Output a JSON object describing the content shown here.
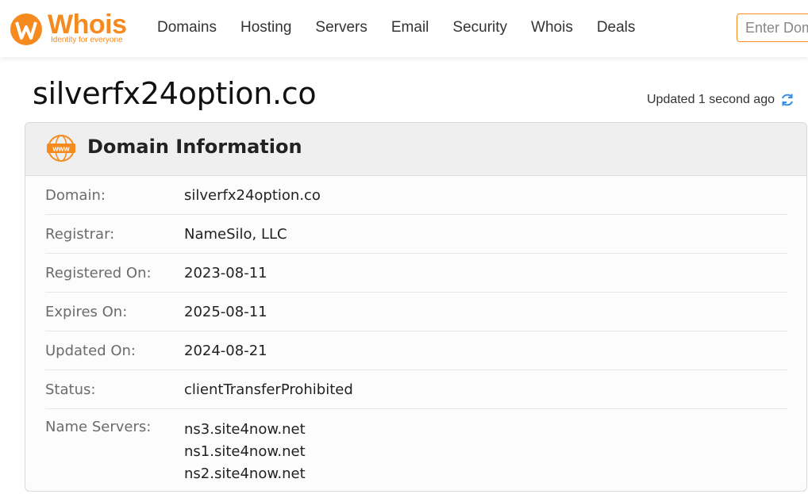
{
  "header": {
    "logo_text": "Whois",
    "logo_tagline": "Identity for everyone",
    "nav": [
      "Domains",
      "Hosting",
      "Servers",
      "Email",
      "Security",
      "Whois",
      "Deals"
    ],
    "search_placeholder": "Enter Domain or IP"
  },
  "page": {
    "title": "silverfx24option.co",
    "updated_text": "Updated 1 second ago"
  },
  "card": {
    "title": "Domain Information",
    "icon_text": "www",
    "rows": [
      {
        "label": "Domain:",
        "value": "silverfx24option.co"
      },
      {
        "label": "Registrar:",
        "value": "NameSilo, LLC"
      },
      {
        "label": "Registered On:",
        "value": "2023-08-11"
      },
      {
        "label": "Expires On:",
        "value": "2025-08-11"
      },
      {
        "label": "Updated On:",
        "value": "2024-08-21"
      },
      {
        "label": "Status:",
        "value": "clientTransferProhibited"
      }
    ],
    "name_servers_label": "Name Servers:",
    "name_servers": [
      "ns3.site4now.net",
      "ns1.site4now.net",
      "ns2.site4now.net"
    ]
  },
  "colors": {
    "brand_orange": "#f58a1f",
    "refresh_blue": "#3b8ee8"
  }
}
